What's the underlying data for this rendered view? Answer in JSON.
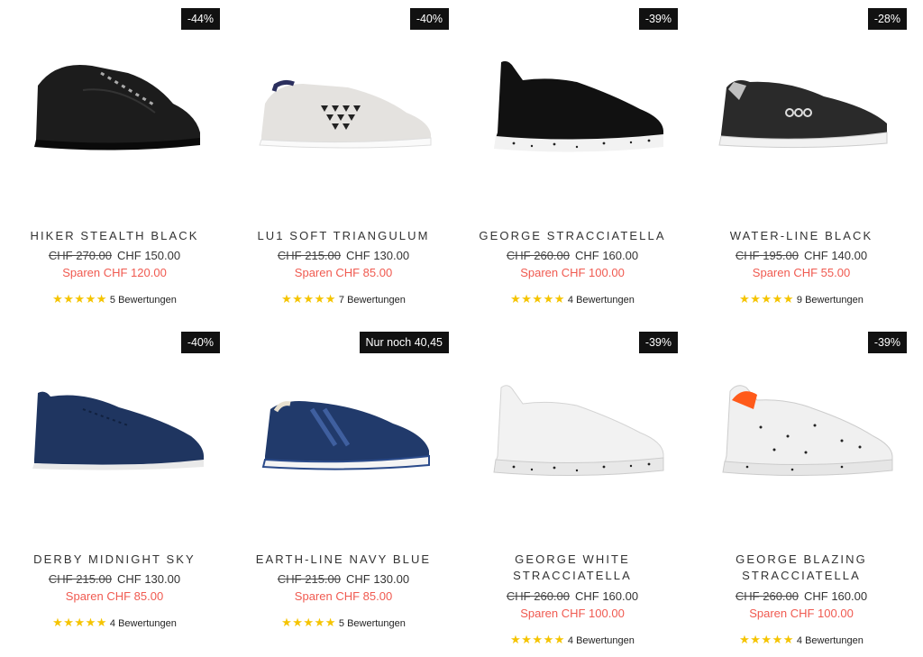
{
  "products": [
    {
      "name": "HIKER STEALTH BLACK",
      "badge": "-44%",
      "old_price": "CHF 270.00",
      "new_price": "CHF 150.00",
      "save": "Sparen CHF 120.00",
      "stars": "★★★★★",
      "reviews": "5 Bewertungen",
      "image": "black-high-top-boot"
    },
    {
      "name": "LU1 SOFT TRIANGULUM",
      "badge": "-40%",
      "old_price": "CHF 215.00",
      "new_price": "CHF 130.00",
      "save": "Sparen CHF 85.00",
      "stars": "★★★★★",
      "reviews": "7 Bewertungen",
      "image": "grey-perforated-sneaker"
    },
    {
      "name": "GEORGE STRACCIATELLA",
      "badge": "-39%",
      "old_price": "CHF 260.00",
      "new_price": "CHF 160.00",
      "save": "Sparen CHF 100.00",
      "stars": "★★★★★",
      "reviews": "4 Bewertungen",
      "image": "black-sneaker-speckled-sole"
    },
    {
      "name": "WATER-LINE BLACK",
      "badge": "-28%",
      "old_price": "CHF 195.00",
      "new_price": "CHF 140.00",
      "save": "Sparen CHF 55.00",
      "stars": "★★★★★",
      "reviews": "9 Bewertungen",
      "image": "black-knit-sneaker"
    },
    {
      "name": "DERBY MIDNIGHT SKY",
      "badge": "-40%",
      "old_price": "CHF 215.00",
      "new_price": "CHF 130.00",
      "save": "Sparen CHF 85.00",
      "stars": "★★★★★",
      "reviews": "4 Bewertungen",
      "image": "navy-suede-derby"
    },
    {
      "name": "EARTH-LINE NAVY BLUE",
      "badge": "Nur noch 40,45",
      "old_price": "CHF 215.00",
      "new_price": "CHF 130.00",
      "save": "Sparen CHF 85.00",
      "stars": "★★★★★",
      "reviews": "5 Bewertungen",
      "image": "navy-runner-sneaker"
    },
    {
      "name": "GEORGE WHITE STRACCIATELLA",
      "badge": "-39%",
      "old_price": "CHF 260.00",
      "new_price": "CHF 160.00",
      "save": "Sparen CHF 100.00",
      "stars": "★★★★★",
      "reviews": "4 Bewertungen",
      "image": "white-sneaker-speckled-sole"
    },
    {
      "name": "GEORGE BLAZING STRACCIATELLA",
      "badge": "-39%",
      "old_price": "CHF 260.00",
      "new_price": "CHF 160.00",
      "save": "Sparen CHF 100.00",
      "stars": "★★★★★",
      "reviews": "4 Bewertungen",
      "image": "white-speckled-sneaker-orange-collar"
    }
  ],
  "colors": {
    "badge_bg": "#111111",
    "save": "#f05a50",
    "star": "#f5c400"
  }
}
